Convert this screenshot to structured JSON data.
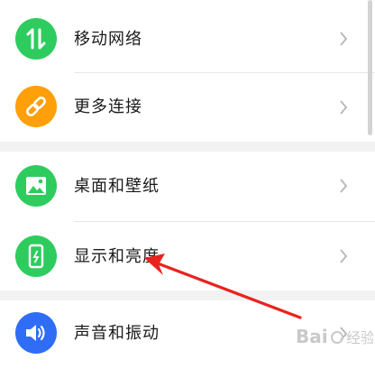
{
  "settings": {
    "items": [
      {
        "label": "移动网络",
        "icon": "mobile-data-icon",
        "color": "#2ecc5e"
      },
      {
        "label": "更多连接",
        "icon": "link-icon",
        "color": "#ff9f0a"
      },
      {
        "label": "桌面和壁纸",
        "icon": "wallpaper-icon",
        "color": "#2ecc5e"
      },
      {
        "label": "显示和亮度",
        "icon": "display-icon",
        "color": "#2ecc5e"
      },
      {
        "label": "声音和振动",
        "icon": "sound-icon",
        "color": "#2f6df6"
      }
    ]
  },
  "annotation": {
    "arrow_color": "#e8231f"
  },
  "watermark": {
    "text": "Bai经验"
  }
}
